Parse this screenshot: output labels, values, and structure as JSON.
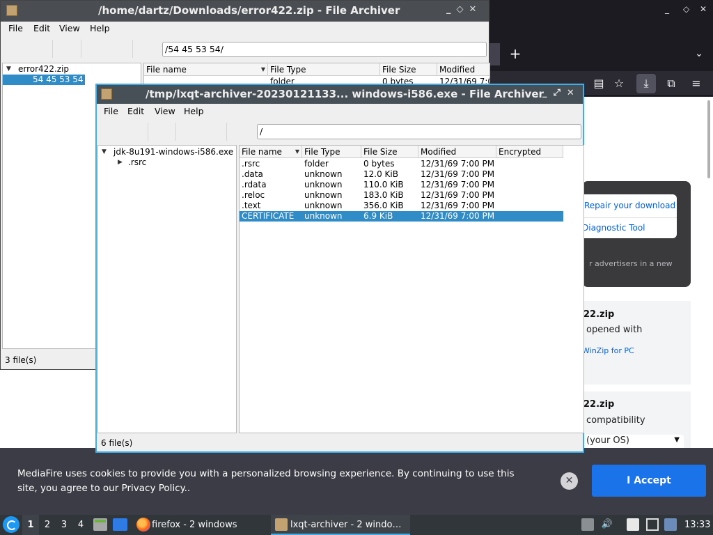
{
  "firefox": {
    "new_tab_glyph": "+",
    "all_tabs_glyph": "⌄",
    "win_min": "_",
    "win_max": "◇",
    "win_close": "✕",
    "toolbar": {
      "reader_glyph": "▤",
      "bookmark_glyph": "☆",
      "download_glyph": "⤓",
      "extensions_glyph": "⧉",
      "menu_glyph": "≡"
    }
  },
  "mediafire": {
    "repair_link": "Repair your download",
    "diagnostic_link": "Diagnostic Tool",
    "advertisers_text": "r advertisers in a new",
    "card1": {
      "title": "22.zip",
      "subtitle": "opened with",
      "link": "WinZip for PC"
    },
    "card2": {
      "title": "22.zip",
      "subtitle": "compatibility"
    },
    "os_select": "(your OS)",
    "cookie_text": "MediaFire uses cookies to provide you with a personalized browsing experience. By continuing to use this site, you agree to our Privacy Policy..",
    "cookie_close": "✕",
    "cookie_accept": "I Accept"
  },
  "archiver_back": {
    "title": "/home/dartz/Downloads/error422.zip - File Archiver",
    "buttons": "_◇✕",
    "menu": [
      "File",
      "Edit",
      "View",
      "Help"
    ],
    "path": "/54 45 53 54/",
    "tree": [
      {
        "label": "error422.zip",
        "expanded": true
      },
      {
        "label": "54 45 53 54",
        "selected": true
      }
    ],
    "columns": [
      "File name",
      "File Type",
      "File Size",
      "Modified"
    ],
    "rows": [
      {
        "name": "",
        "type": "folder",
        "size": "0 bytes",
        "modified": "12/31/69 7:0"
      }
    ],
    "status": "3 file(s)"
  },
  "archiver_front": {
    "title": "/tmp/lxqt-archiver-20230121133... windows-i586.exe - File Archiver",
    "buttons": "_⤢✕",
    "menu": [
      "File",
      "Edit",
      "View",
      "Help"
    ],
    "path": "/",
    "tree": [
      {
        "label": "jdk-8u191-windows-i586.exe"
      },
      {
        "label": ".rsrc"
      }
    ],
    "columns": [
      "File name",
      "File Type",
      "File Size",
      "Modified",
      "Encrypted"
    ],
    "rows": [
      {
        "name": ".rsrc",
        "type": "folder",
        "size": "0 bytes",
        "modified": "12/31/69 7:00 PM"
      },
      {
        "name": ".data",
        "type": "unknown",
        "size": "12.0 KiB",
        "modified": "12/31/69 7:00 PM"
      },
      {
        "name": ".rdata",
        "type": "unknown",
        "size": "110.0 KiB",
        "modified": "12/31/69 7:00 PM"
      },
      {
        "name": ".reloc",
        "type": "unknown",
        "size": "183.0 KiB",
        "modified": "12/31/69 7:00 PM"
      },
      {
        "name": ".text",
        "type": "unknown",
        "size": "356.0 KiB",
        "modified": "12/31/69 7:00 PM"
      },
      {
        "name": "CERTIFICATE",
        "type": "unknown",
        "size": "6.9 KiB",
        "modified": "12/31/69 7:00 PM",
        "selected": true
      }
    ],
    "status": "6 file(s)"
  },
  "taskbar": {
    "workspaces": [
      "1",
      "2",
      "3",
      "4"
    ],
    "firefox_task": "firefox - 2 windows",
    "archiver_task": "lxqt-archiver - 2 windo…",
    "volume_glyph": "🔊",
    "clock": "13:33"
  },
  "colors": {
    "selection": "#308cc6",
    "accent": "#3daee9",
    "accept_button": "#1a73e8",
    "link": "#0061e0"
  }
}
